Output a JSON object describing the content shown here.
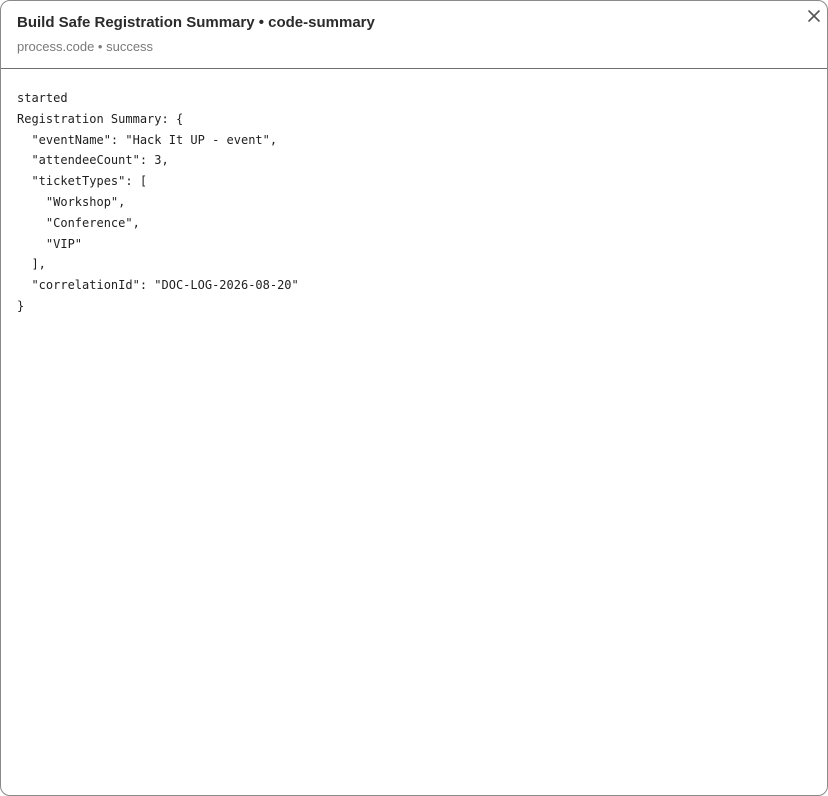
{
  "header": {
    "title": "Build Safe Registration Summary • code-summary",
    "subtitle": "process.code • success",
    "close_icon": "close-icon"
  },
  "output": {
    "lines": [
      "started",
      "Registration Summary: {",
      "  \"eventName\": \"Hack It UP - event\",",
      "  \"attendeeCount\": 3,",
      "  \"ticketTypes\": [",
      "    \"Workshop\",",
      "    \"Conference\",",
      "    \"VIP\"",
      "  ],",
      "  \"correlationId\": \"DOC-LOG-2026-08-20\"",
      "}"
    ]
  }
}
